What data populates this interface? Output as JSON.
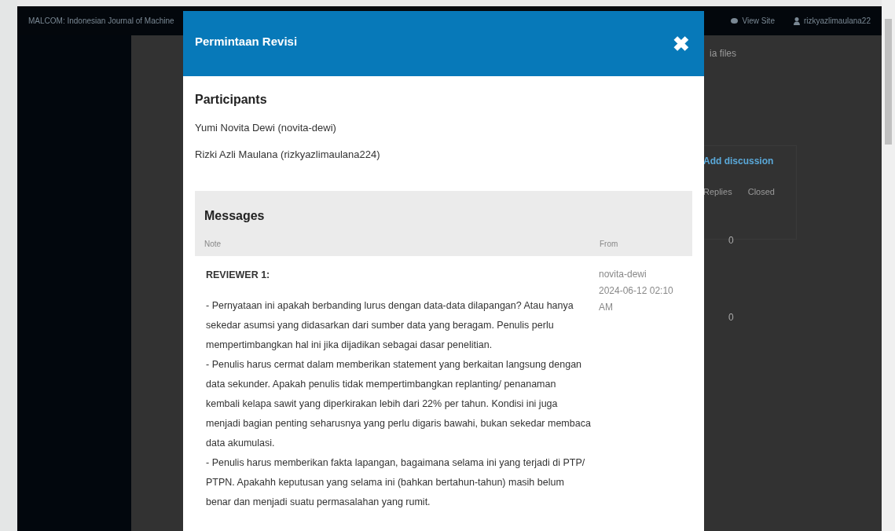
{
  "background": {
    "site_title": "MALCOM: Indonesian Journal of Machine",
    "view_site": "View Site",
    "user": "rizkyazlimaulana22",
    "files_fragment": "ia files",
    "add_discussion": "Add discussion",
    "columns": [
      "Replies",
      "Closed"
    ],
    "rows": [
      {
        "replies": "0"
      },
      {
        "replies": "0"
      }
    ]
  },
  "modal": {
    "title": "Permintaan Revisi",
    "close": "✖",
    "participants": {
      "heading": "Participants",
      "names": [
        "Yumi Novita Dewi (novita-dewi)",
        "Rizki Azli Maulana (rizkyazlimaulana224)"
      ]
    },
    "messages": {
      "heading": "Messages",
      "columns": [
        "Note",
        "From"
      ],
      "items": [
        {
          "title": "REVIEWER 1:",
          "paragraphs": [
            "- Pernyataan ini apakah berbanding lurus dengan data-data dilapangan? Atau hanya sekedar asumsi yang didasarkan dari sumber data yang beragam. Penulis perlu mempertimbangkan hal ini jika dijadikan sebagai dasar penelitian.",
            "- Penulis harus cermat dalam memberikan statement yang berkaitan langsung dengan data sekunder. Apakah penulis tidak mempertimbangkan replanting/ penanaman kembali kelapa sawit yang diperkirakan lebih dari 22% per tahun. Kondisi ini juga menjadi bagian penting seharusnya yang perlu digaris bawahi, bukan sekedar membaca data akumulasi.",
            "- Penulis harus memberikan fakta lapangan, bagaimana selama ini yang terjadi di PTP/ PTPN. Apakahh keputusan yang selama ini (bahkan bertahun-tahun) masih belum benar dan menjadi suatu permasalahan yang rumit."
          ],
          "from": "novita-dewi",
          "date": "2024-06-12 02:10 AM"
        }
      ]
    }
  }
}
